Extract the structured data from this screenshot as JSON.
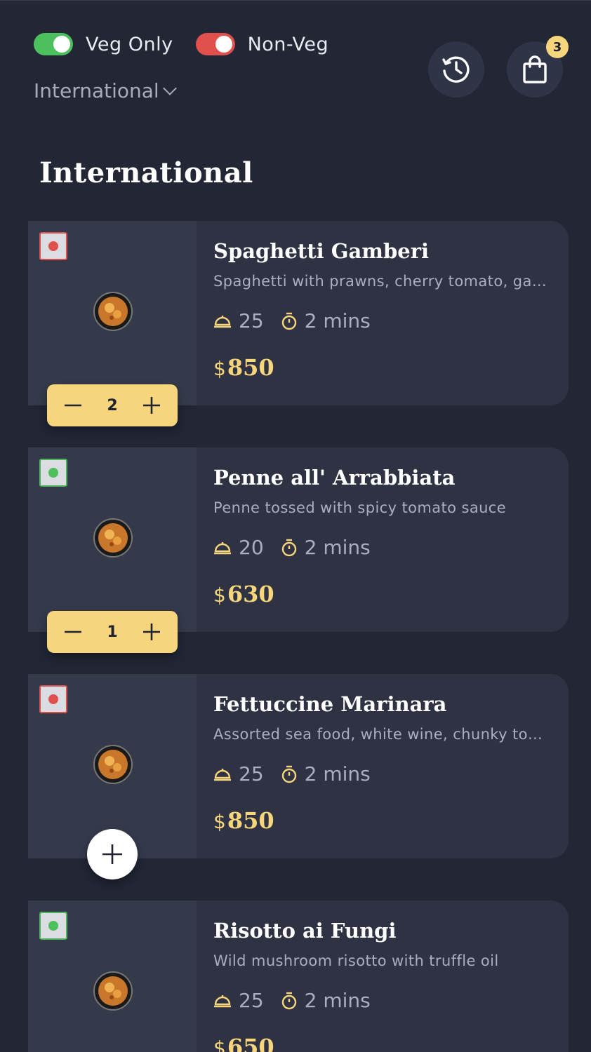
{
  "filters": {
    "veg_label": "Veg Only",
    "nonveg_label": "Non-Veg",
    "category": "International"
  },
  "header": {
    "cart_count": "3"
  },
  "section": {
    "title": "International"
  },
  "colors": {
    "accent": "#f6d57c",
    "veg": "#4cc05d",
    "nonveg": "#e0504c",
    "background": "#222635"
  },
  "items": [
    {
      "name": "Spaghetti Gamberi",
      "description": "Spaghetti with prawns, cherry tomato, garlic and chili",
      "serves": "25",
      "time": "2 mins",
      "currency": "$",
      "price": "850",
      "type": "non-veg",
      "quantity": "2"
    },
    {
      "name": "Penne all' Arrabbiata",
      "description": "Penne tossed with spicy tomato sauce",
      "serves": "20",
      "time": "2 mins",
      "currency": "$",
      "price": "630",
      "type": "veg",
      "quantity": "1"
    },
    {
      "name": "Fettuccine Marinara",
      "description": "Assorted sea food, white wine, chunky tomato sauce",
      "serves": "25",
      "time": "2 mins",
      "currency": "$",
      "price": "850",
      "type": "non-veg",
      "quantity": ""
    },
    {
      "name": "Risotto ai Fungi",
      "description": "Wild mushroom risotto with truffle oil",
      "serves": "25",
      "time": "2 mins",
      "currency": "$",
      "price": "650",
      "type": "veg",
      "quantity": ""
    }
  ]
}
